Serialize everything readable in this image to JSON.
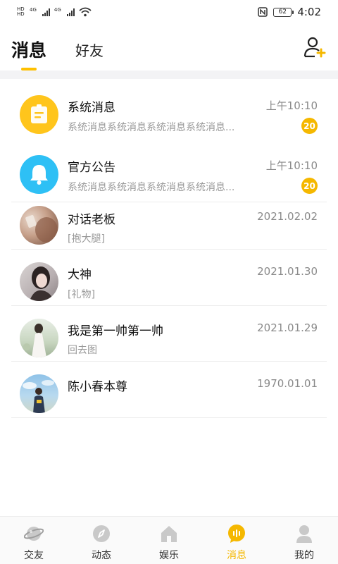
{
  "status_bar": {
    "network_left": "4G",
    "network_right": "4G",
    "battery": "62",
    "time": "4:02"
  },
  "header": {
    "tabs": [
      {
        "label": "消息",
        "active": true
      },
      {
        "label": "好友",
        "active": false
      }
    ],
    "add_friend_icon": "user-plus-icon"
  },
  "colors": {
    "accent": "#f5b800",
    "system_icon_bg": "#ffc51c",
    "announce_icon_bg": "#2ec0f5",
    "muted_text": "#999999"
  },
  "messages": [
    {
      "name": "系统消息",
      "time": "上午10:10",
      "preview": "系统消息系统消息系统消息系统消息...",
      "badge": "20",
      "icon": "system-message-icon"
    },
    {
      "name": "官方公告",
      "time": "上午10:10",
      "preview": "系统消息系统消息系统消息系统消息...",
      "badge": "20",
      "icon": "bell-icon"
    },
    {
      "name": "对话老板",
      "time": "2021.02.02",
      "preview": "[抱大腿]",
      "icon": "avatar-photo"
    },
    {
      "name": "大神",
      "time": "2021.01.30",
      "preview": "[礼物]",
      "icon": "avatar-photo"
    },
    {
      "name": "我是第一帅第一帅",
      "time": "2021.01.29",
      "preview": "回去图",
      "icon": "avatar-photo"
    },
    {
      "name": "陈小春本尊",
      "time": "1970.01.01",
      "preview": "",
      "icon": "avatar-photo"
    }
  ],
  "bottom_nav": [
    {
      "label": "交友",
      "icon": "planet-icon",
      "active": false
    },
    {
      "label": "动态",
      "icon": "compass-icon",
      "active": false
    },
    {
      "label": "娱乐",
      "icon": "home-icon",
      "active": false
    },
    {
      "label": "消息",
      "icon": "chat-bubble-icon",
      "active": true
    },
    {
      "label": "我的",
      "icon": "person-icon",
      "active": false
    }
  ]
}
